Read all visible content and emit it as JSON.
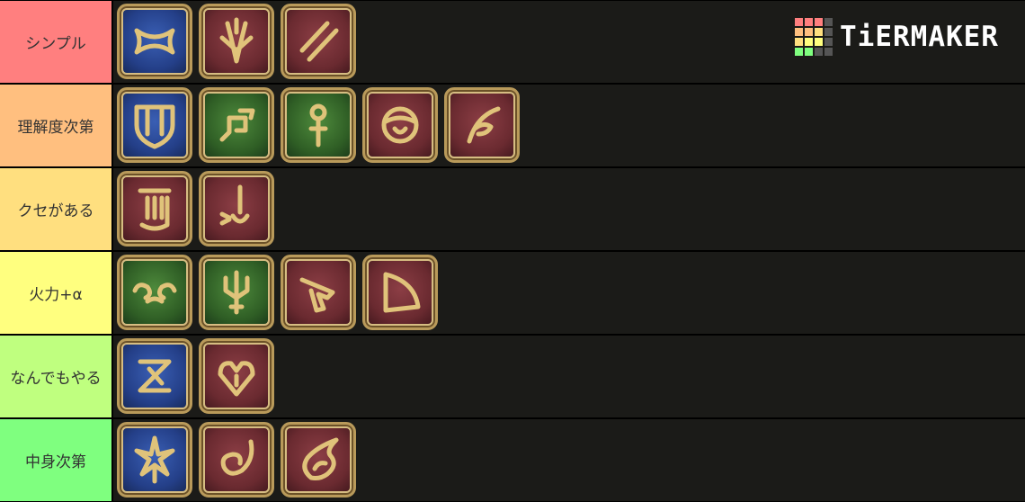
{
  "logo": {
    "text": "TiERMAKER"
  },
  "tiers": [
    {
      "label": "シンプル",
      "color": "#ff7f7f",
      "icons": [
        "blue-winged-job-icon",
        "red-crested-job-icon",
        "red-slash-job-icon"
      ]
    },
    {
      "label": "理解度次第",
      "color": "#ffbf7f",
      "icons": [
        "blue-shield-job-icon",
        "green-glyph-job-icon",
        "green-staff-job-icon",
        "red-orb-job-icon",
        "red-quill-job-icon"
      ]
    },
    {
      "label": "クセがある",
      "color": "#ffdf7f",
      "icons": [
        "red-pillar-job-icon",
        "red-blade-star-job-icon"
      ]
    },
    {
      "label": "火力+α",
      "color": "#ffff7f",
      "icons": [
        "green-swirl-job-icon",
        "green-trident-job-icon",
        "red-gun-job-icon",
        "red-bow-job-icon"
      ]
    },
    {
      "label": "なんでもやる",
      "color": "#bfff7f",
      "icons": [
        "blue-zigzag-job-icon",
        "red-heart-job-icon"
      ]
    },
    {
      "label": "中身次第",
      "color": "#7fff7f",
      "icons": [
        "blue-star-job-icon",
        "red-spiral-job-icon",
        "red-flame-job-icon"
      ]
    }
  ]
}
